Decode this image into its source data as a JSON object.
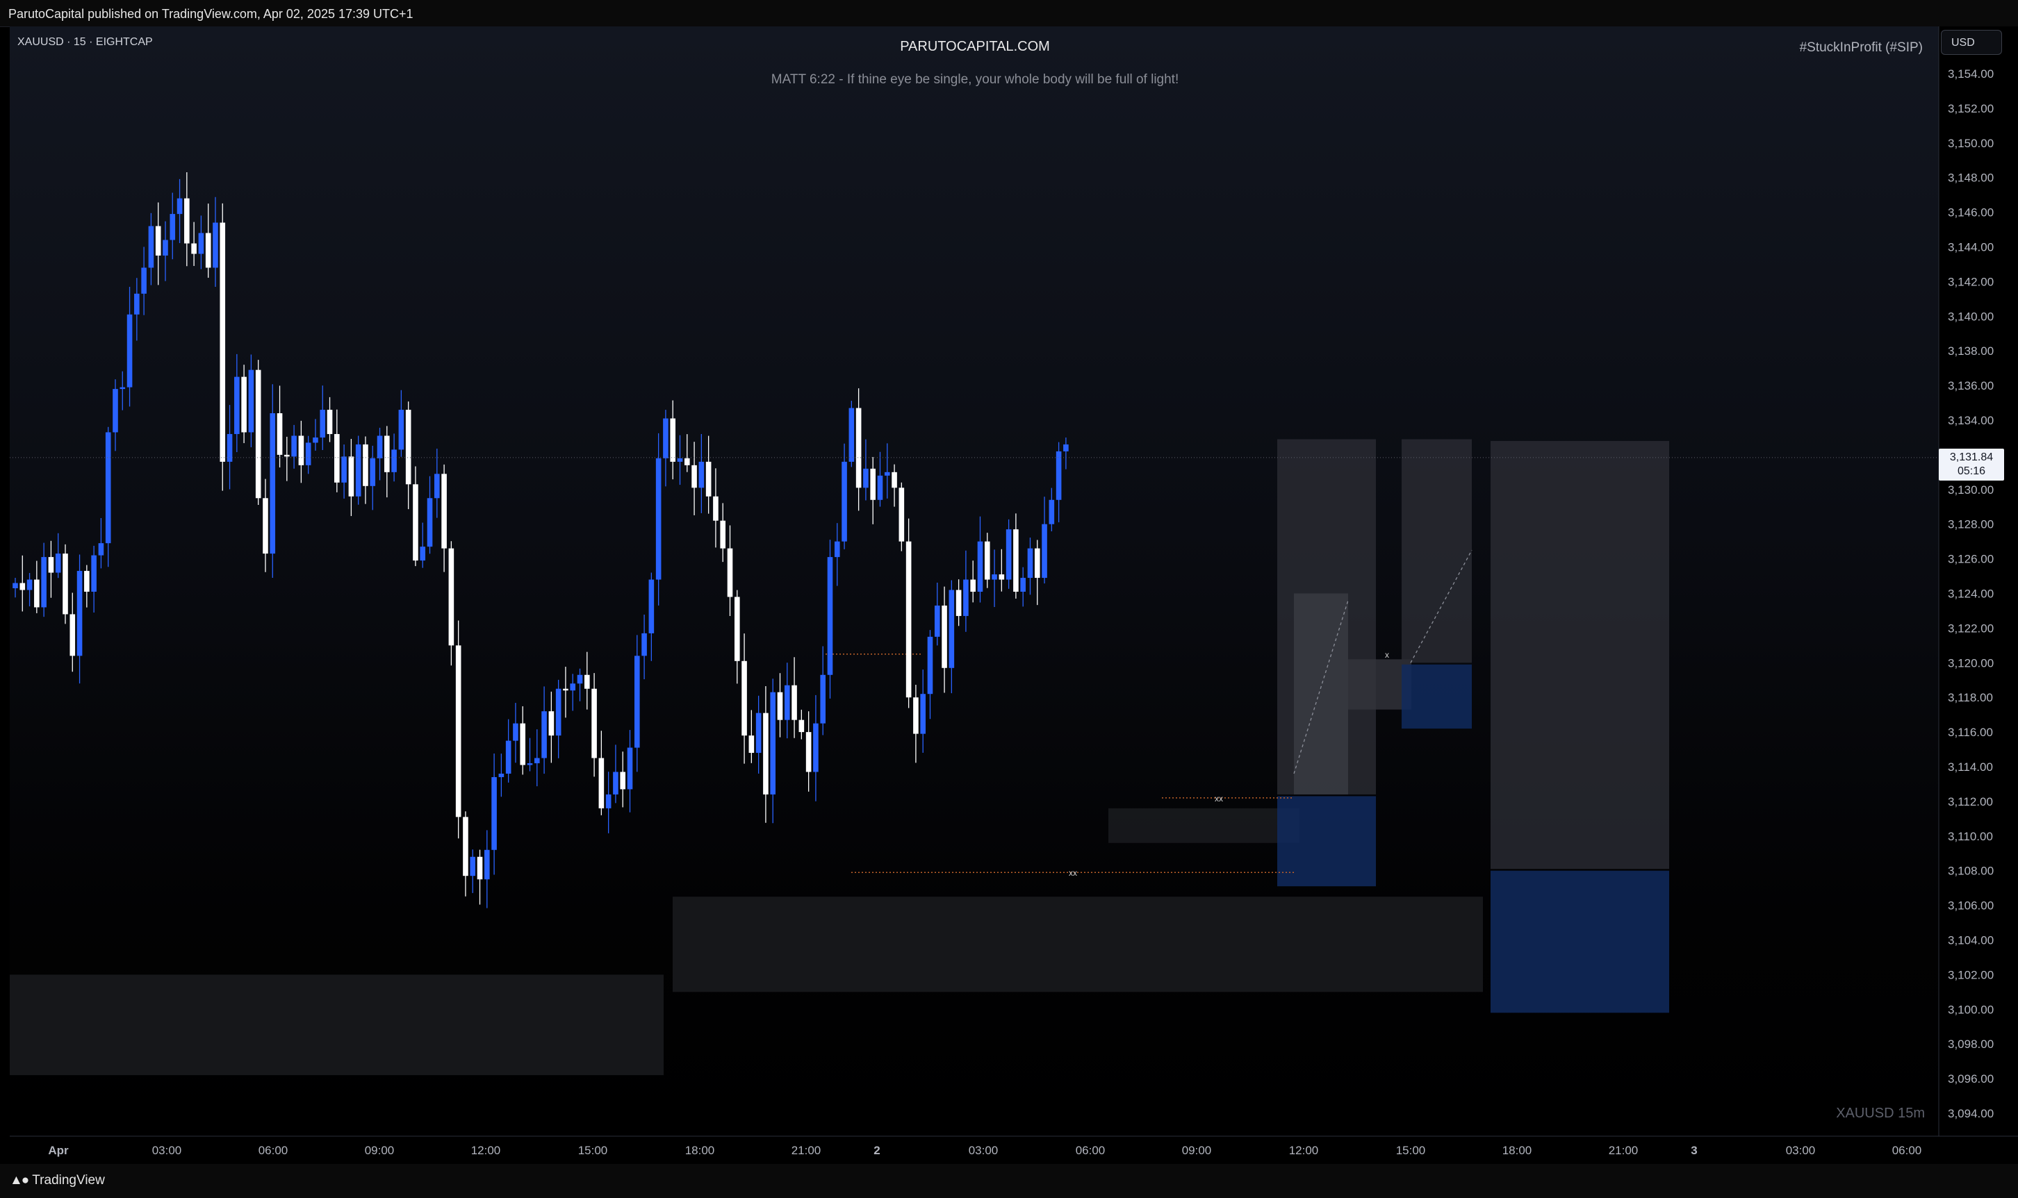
{
  "header": {
    "published": "ParutoCapital published on TradingView.com, Apr 02, 2025 17:39 UTC+1"
  },
  "chart_header": {
    "symbol": "XAUUSD · 15 · EIGHTCAP",
    "brand": "PARUTOCAPITAL.COM",
    "verse": "MATT 6:22 - If thine eye be single, your whole body will be full of light!",
    "hashtag": "#StuckInProfit (#SIP)",
    "currency": "USD",
    "watermark": "XAUUSD   15m"
  },
  "footer": {
    "brand": "TradingView"
  },
  "colors": {
    "bull": "#2962ff",
    "bear": "#ffffff",
    "zone_gray": "#2a2c33",
    "zone_blue": "#102a5e",
    "dotted_orange": "#c0622a"
  },
  "chart_data": {
    "type": "candlestick",
    "symbol": "XAUUSD",
    "timeframe": "15",
    "exchange": "EIGHTCAP",
    "ylim": [
      3092.8,
      3155.9
    ],
    "y_ticks": [
      "3,154.00",
      "3,152.00",
      "3,150.00",
      "3,148.00",
      "3,146.00",
      "3,144.00",
      "3,142.00",
      "3,140.00",
      "3,138.00",
      "3,136.00",
      "3,134.00",
      "3,132.00",
      "3,130.00",
      "3,128.00",
      "3,126.00",
      "3,124.00",
      "3,122.00",
      "3,120.00",
      "3,118.00",
      "3,116.00",
      "3,114.00",
      "3,112.00",
      "3,110.00",
      "3,108.00",
      "3,106.00",
      "3,104.00",
      "3,102.00",
      "3,100.00",
      "3,098.00",
      "3,096.00",
      "3,094.00"
    ],
    "x_ticks": [
      "Apr",
      "03:00",
      "06:00",
      "09:00",
      "12:00",
      "15:00",
      "18:00",
      "21:00",
      "2",
      "03:00",
      "06:00",
      "09:00",
      "12:00",
      "15:00",
      "18:00",
      "21:00",
      "3",
      "03:00",
      "06:00"
    ],
    "last_price": "3,131.84",
    "countdown": "05:16",
    "closes": [
      3124.6,
      3124.2,
      3124.8,
      3123.2,
      3126.1,
      3125.2,
      3126.3,
      3122.8,
      3120.4,
      3125.3,
      3124.1,
      3126.2,
      3126.9,
      3133.3,
      3135.8,
      3135.9,
      3140.1,
      3141.3,
      3142.8,
      3145.2,
      3143.5,
      3144.4,
      3145.9,
      3146.8,
      3144.2,
      3143.6,
      3144.8,
      3142.8,
      3145.4,
      3131.6,
      3133.2,
      3136.5,
      3133.3,
      3136.9,
      3129.5,
      3126.3,
      3134.4,
      3132.0,
      3131.9,
      3133.1,
      3131.4,
      3132.7,
      3133.0,
      3134.6,
      3133.2,
      3130.4,
      3131.9,
      3129.6,
      3132.6,
      3130.2,
      3131.8,
      3133.1,
      3131.0,
      3132.3,
      3134.6,
      3130.3,
      3125.9,
      3126.7,
      3129.5,
      3130.9,
      3126.6,
      3121.0,
      3111.1,
      3107.7,
      3108.8,
      3107.5,
      3109.2,
      3113.4,
      3113.6,
      3115.5,
      3116.5,
      3114.1,
      3114.2,
      3114.5,
      3117.2,
      3115.8,
      3118.5,
      3118.4,
      3118.8,
      3119.3,
      3118.5,
      3114.5,
      3111.6,
      3112.4,
      3113.7,
      3112.7,
      3115.1,
      3120.4,
      3121.7,
      3124.8,
      3131.8,
      3134.1,
      3131.6,
      3131.8,
      3131.4,
      3130.1,
      3131.6,
      3129.6,
      3128.2,
      3126.6,
      3123.8,
      3120.1,
      3115.8,
      3114.8,
      3117.1,
      3112.4,
      3118.3,
      3116.7,
      3118.7,
      3116.7,
      3116.0,
      3113.7,
      3116.5,
      3119.3,
      3126.1,
      3127.0,
      3131.6,
      3134.7,
      3130.1,
      3131.2,
      3129.4,
      3130.8,
      3131.0,
      3130.1,
      3127.0,
      3118.0,
      3115.9,
      3118.2,
      3121.5,
      3123.3,
      3119.7,
      3124.2,
      3122.7,
      3124.8,
      3124.1,
      3127.0,
      3124.8,
      3125.1,
      3124.8,
      3127.7,
      3124.1,
      3124.9,
      3126.6,
      3124.9,
      3128.0,
      3129.4,
      3132.2,
      3132.6
    ]
  }
}
